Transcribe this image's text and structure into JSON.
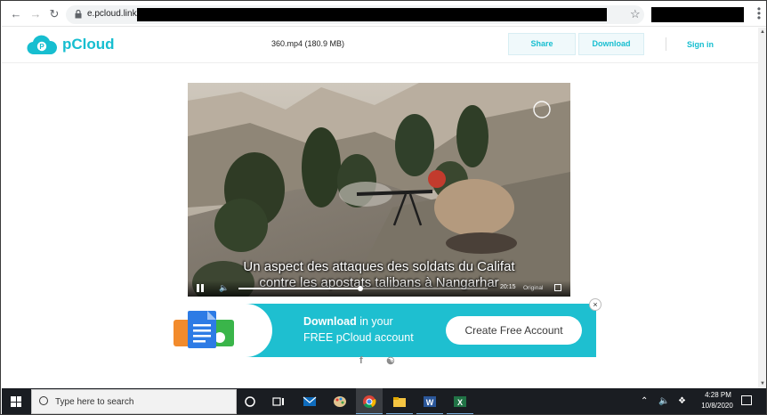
{
  "browser": {
    "url": "e.pcloud.link/",
    "icons": [
      "back-icon",
      "forward-icon",
      "reload-icon",
      "lock-icon",
      "bookmark-star-icon",
      "menu-icon"
    ]
  },
  "header": {
    "logo_text": "pCloud",
    "file_title": "360.mp4 (180.9 MB)",
    "share_label": "Share",
    "download_label": "Download",
    "signin_label": "Sign in",
    "brand_color": "#17bed0"
  },
  "video": {
    "subtitle_line1": "Un aspect des attaques des soldats du Califat",
    "subtitle_line2": "contre les apostats talibans à Nangarhar",
    "time": "20:15",
    "quality": "Original",
    "progress": 0.49
  },
  "ad": {
    "line1_bold": "Download",
    "line1_rest": " in your",
    "line2": "FREE pCloud account",
    "cta_label": "Create Free Account",
    "close_label": "×",
    "bg_color": "#1ebfd0"
  },
  "taskbar": {
    "search_placeholder": "Type here to search",
    "time": "4:28 PM",
    "date": "10/8/2020",
    "icons": [
      "cortana-icon",
      "task-view-icon",
      "mail-icon",
      "paint-icon",
      "chrome-icon",
      "file-explorer-icon",
      "word-icon",
      "excel-icon"
    ]
  }
}
